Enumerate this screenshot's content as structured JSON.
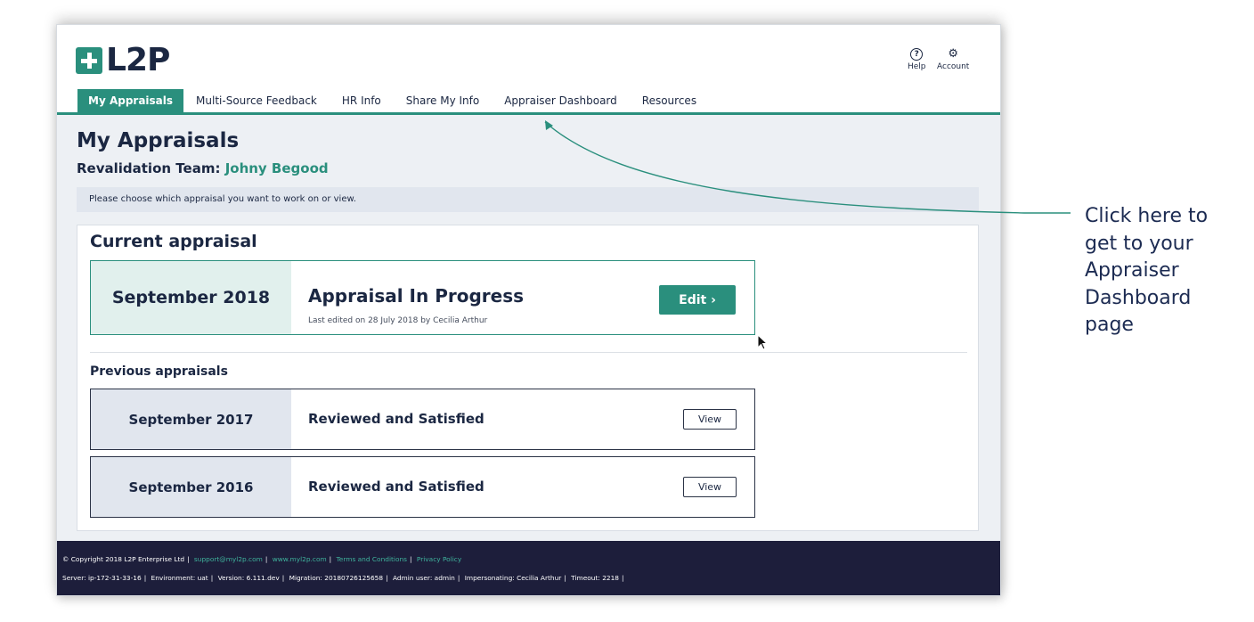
{
  "app": {
    "logo_text": "L2P",
    "help_label": "Help",
    "account_label": "Account"
  },
  "tabs": [
    {
      "label": "My Appraisals",
      "active": true
    },
    {
      "label": "Multi-Source Feedback"
    },
    {
      "label": "HR Info"
    },
    {
      "label": "Share My Info"
    },
    {
      "label": "Appraiser Dashboard"
    },
    {
      "label": "Resources"
    }
  ],
  "page": {
    "title": "My Appraisals",
    "team_label": "Revalidation Team:",
    "team_name": "Johny Begood",
    "notice": "Please choose which appraisal you want to work on or view."
  },
  "current": {
    "heading": "Current appraisal",
    "date": "September 2018",
    "status": "Appraisal In Progress",
    "edited": "Last edited on 28 July 2018 by Cecilia Arthur",
    "button": "Edit ›"
  },
  "previous": {
    "heading": "Previous appraisals",
    "items": [
      {
        "date": "September 2017",
        "status": "Reviewed and Satisfied",
        "button": "View"
      },
      {
        "date": "September 2016",
        "status": "Reviewed and Satisfied",
        "button": "View"
      }
    ]
  },
  "footer": {
    "copyright": "© Copyright 2018 L2P Enterprise Ltd",
    "email": "support@myl2p.com",
    "website": "www.myl2p.com",
    "terms": "Terms and Conditions",
    "privacy": "Privacy Policy",
    "server": "Server: ip-172-31-33-16",
    "environment": "Environment: uat",
    "version": "Version: 6.111.dev",
    "migration": "Migration: 20180726125658",
    "admin": "Admin user: admin",
    "impersonating": "Impersonating: Cecilia Arthur",
    "timeout": "Timeout: 2218"
  },
  "callout": {
    "lines": [
      "Click here to",
      "get to your",
      "Appraiser",
      "Dashboard",
      "page"
    ]
  },
  "colors": {
    "brand_teal": "#2a8f7d",
    "navy": "#1b2742",
    "footer_bg": "#1d1e3b"
  },
  "icons": [
    "help-icon",
    "gear-icon",
    "cursor-icon"
  ]
}
